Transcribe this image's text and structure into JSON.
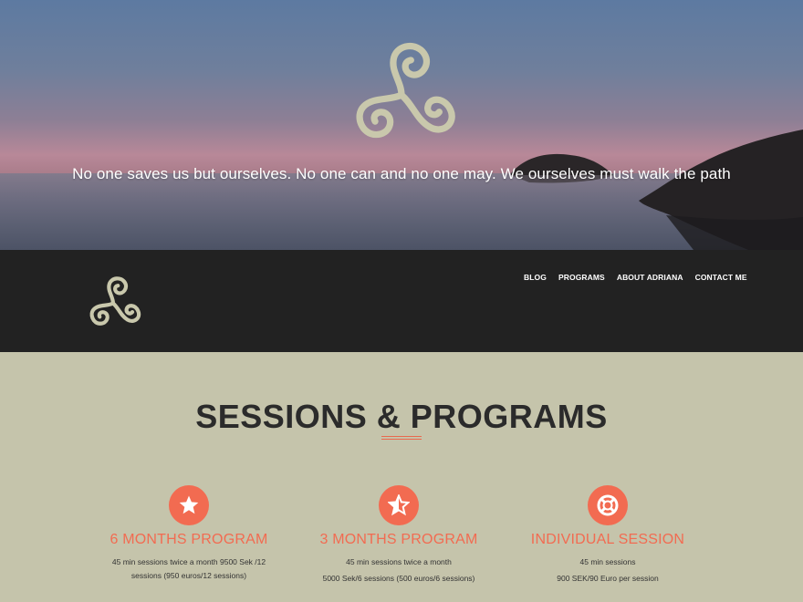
{
  "hero": {
    "quote": "No one saves us but ourselves. No one can and no one may. We ourselves must walk the path",
    "logo_icon": "triskelion-icon"
  },
  "nav": {
    "logo_icon": "triskelion-icon",
    "items": [
      {
        "label": "BLOG"
      },
      {
        "label": "PROGRAMS"
      },
      {
        "label": "ABOUT ADRIANA"
      },
      {
        "label": "CONTACT ME"
      }
    ]
  },
  "section": {
    "title": "SESSIONS & PROGRAMS",
    "cards": [
      {
        "icon": "star-icon",
        "title": "6 MONTHS PROGRAM",
        "lines": [
          "45 min sessions twice a month 9500 Sek /12 sessions (950 euros/12 sessions)"
        ]
      },
      {
        "icon": "half-star-icon",
        "title": "3 MONTHS PROGRAM",
        "lines": [
          "45 min sessions twice a month",
          "5000 Sek/6 sessions (500 euros/6 sessions)"
        ]
      },
      {
        "icon": "life-ring-icon",
        "title": "INDIVIDUAL SESSION",
        "lines": [
          "45 min sessions",
          "900 SEK/90 Euro per session"
        ]
      }
    ]
  },
  "colors": {
    "accent": "#f26b51",
    "navbar_bg": "#222222",
    "section_bg": "#c5c4ab",
    "logo_fill": "#c9c8ac"
  }
}
